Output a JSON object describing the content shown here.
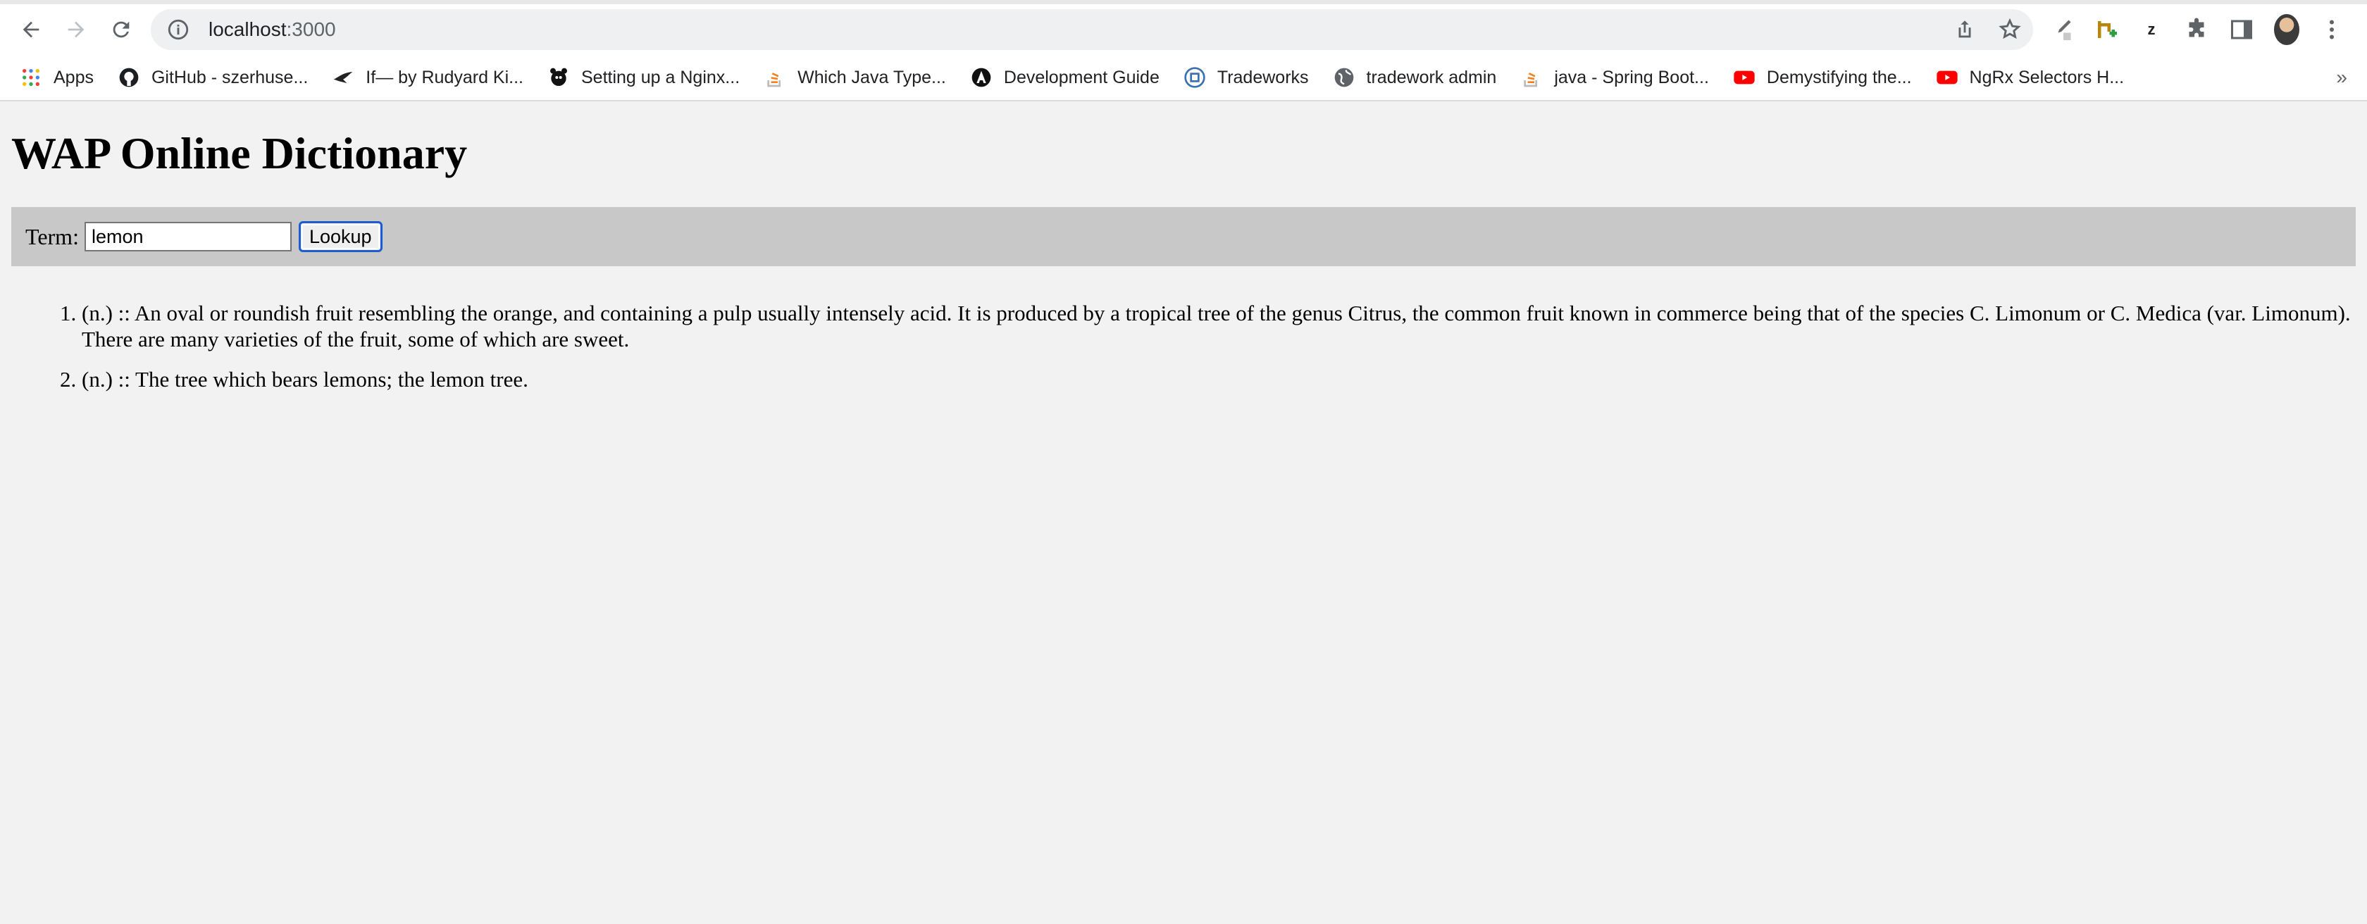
{
  "browser": {
    "url_host": "localhost",
    "url_port": ":3000",
    "bookmarks": [
      {
        "label": "Apps",
        "icon": "apps-grid-icon"
      },
      {
        "label": "GitHub - szerhuse...",
        "icon": "github-icon"
      },
      {
        "label": "If— by Rudyard Ki...",
        "icon": "bird-icon"
      },
      {
        "label": "Setting up a Nginx...",
        "icon": "nginx-icon"
      },
      {
        "label": "Which Java Type...",
        "icon": "stackoverflow-icon"
      },
      {
        "label": "Development Guide",
        "icon": "angular-icon"
      },
      {
        "label": "Tradeworks",
        "icon": "tradeworks-icon"
      },
      {
        "label": "tradework admin",
        "icon": "globe-icon"
      },
      {
        "label": "java - Spring Boot...",
        "icon": "stackoverflow-icon"
      },
      {
        "label": "Demystifying the...",
        "icon": "youtube-icon"
      },
      {
        "label": "NgRx Selectors H...",
        "icon": "youtube-icon"
      }
    ],
    "more_bookmarks": "»"
  },
  "page": {
    "title": "WAP Online Dictionary",
    "term_label": "Term:",
    "term_value": "lemon",
    "lookup_label": "Lookup",
    "results": [
      "(n.) :: An oval or roundish fruit resembling the orange, and containing a pulp usually intensely acid. It is produced by a tropical tree of the genus Citrus, the common fruit known in commerce being that of the species C. Limonum or C. Medica (var. Limonum). There are many varieties of the fruit, some of which are sweet.",
      "(n.) :: The tree which bears lemons; the lemon tree."
    ]
  }
}
